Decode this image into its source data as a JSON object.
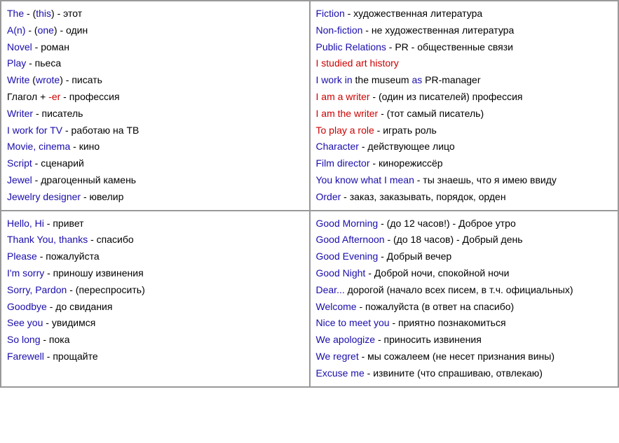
{
  "topLeft": {
    "lines": [
      {
        "parts": [
          {
            "text": "The",
            "color": "blue"
          },
          {
            "text": " - (",
            "color": "black"
          },
          {
            "text": "this",
            "color": "blue"
          },
          {
            "text": ") - этот",
            "color": "black"
          }
        ]
      },
      {
        "parts": [
          {
            "text": "A(n)",
            "color": "blue"
          },
          {
            "text": " - (",
            "color": "black"
          },
          {
            "text": "one",
            "color": "blue"
          },
          {
            "text": ") - один",
            "color": "black"
          }
        ]
      },
      {
        "parts": [
          {
            "text": "Novel",
            "color": "blue"
          },
          {
            "text": " - роман",
            "color": "black"
          }
        ]
      },
      {
        "parts": [
          {
            "text": "Play",
            "color": "blue"
          },
          {
            "text": " - пьеса",
            "color": "black"
          }
        ]
      },
      {
        "parts": [
          {
            "text": "Write",
            "color": "blue"
          },
          {
            "text": " (",
            "color": "black"
          },
          {
            "text": "wrote",
            "color": "blue"
          },
          {
            "text": ") - писать",
            "color": "black"
          }
        ]
      },
      {
        "parts": [
          {
            "text": "Глагол + ",
            "color": "black"
          },
          {
            "text": "-er",
            "color": "red"
          },
          {
            "text": " - профессия",
            "color": "black"
          }
        ]
      },
      {
        "parts": [
          {
            "text": "Writer",
            "color": "blue"
          },
          {
            "text": " - писатель",
            "color": "black"
          }
        ]
      },
      {
        "parts": [
          {
            "text": "I work for TV",
            "color": "blue"
          },
          {
            "text": " - работаю на ТВ",
            "color": "black"
          }
        ]
      },
      {
        "parts": [
          {
            "text": "Movie, cinema",
            "color": "blue"
          },
          {
            "text": " - кино",
            "color": "black"
          }
        ]
      },
      {
        "parts": [
          {
            "text": "Script",
            "color": "blue"
          },
          {
            "text": " - сценарий",
            "color": "black"
          }
        ]
      },
      {
        "parts": [
          {
            "text": "Jewel",
            "color": "blue"
          },
          {
            "text": " - драгоценный камень",
            "color": "black"
          }
        ]
      },
      {
        "parts": [
          {
            "text": "Jewelry designer",
            "color": "blue"
          },
          {
            "text": " - ювелир",
            "color": "black"
          }
        ]
      }
    ]
  },
  "topRight": {
    "lines": [
      {
        "parts": [
          {
            "text": "Fiction",
            "color": "blue"
          },
          {
            "text": " - художественная литература",
            "color": "black"
          }
        ]
      },
      {
        "parts": [
          {
            "text": "Non-fiction",
            "color": "blue"
          },
          {
            "text": " - не художественная литература",
            "color": "black"
          }
        ]
      },
      {
        "parts": [
          {
            "text": "Public Relations",
            "color": "blue"
          },
          {
            "text": " - PR - общественные связи",
            "color": "black"
          }
        ]
      },
      {
        "parts": [
          {
            "text": "I studied art history",
            "color": "red"
          }
        ]
      },
      {
        "parts": [
          {
            "text": "I work in",
            "color": "blue"
          },
          {
            "text": " the museum ",
            "color": "black"
          },
          {
            "text": "as",
            "color": "blue"
          },
          {
            "text": " PR-manager",
            "color": "black"
          }
        ]
      },
      {
        "parts": [
          {
            "text": "I am a writer",
            "color": "red"
          },
          {
            "text": " - (один из писателей) профессия",
            "color": "black"
          }
        ]
      },
      {
        "parts": [
          {
            "text": "I am the writer",
            "color": "red"
          },
          {
            "text": " - (тот самый писатель)",
            "color": "black"
          }
        ]
      },
      {
        "parts": [
          {
            "text": "To play a role",
            "color": "red"
          },
          {
            "text": " - играть роль",
            "color": "black"
          }
        ]
      },
      {
        "parts": [
          {
            "text": "Character",
            "color": "blue"
          },
          {
            "text": " - действующее лицо",
            "color": "black"
          }
        ]
      },
      {
        "parts": [
          {
            "text": "Film director",
            "color": "blue"
          },
          {
            "text": " - кинорежиссёр",
            "color": "black"
          }
        ]
      },
      {
        "parts": [
          {
            "text": "You know what I mean",
            "color": "blue"
          },
          {
            "text": " - ты знаешь, что я имею ввиду",
            "color": "black"
          }
        ]
      },
      {
        "parts": [
          {
            "text": "Order",
            "color": "blue"
          },
          {
            "text": " - заказ, заказывать, порядок, орден",
            "color": "black"
          }
        ]
      }
    ]
  },
  "bottomLeft": {
    "lines": [
      {
        "parts": [
          {
            "text": "Hello, Hi",
            "color": "blue"
          },
          {
            "text": " - привет",
            "color": "black"
          }
        ]
      },
      {
        "parts": [
          {
            "text": "Thank You, thanks",
            "color": "blue"
          },
          {
            "text": " - спасибо",
            "color": "black"
          }
        ]
      },
      {
        "parts": [
          {
            "text": "Please",
            "color": "blue"
          },
          {
            "text": " - пожалуйста",
            "color": "black"
          }
        ]
      },
      {
        "parts": [
          {
            "text": "I'm sorry",
            "color": "blue"
          },
          {
            "text": " - приношу извинения",
            "color": "black"
          }
        ]
      },
      {
        "parts": [
          {
            "text": "Sorry, Pardon",
            "color": "blue"
          },
          {
            "text": " - (переспросить)",
            "color": "black"
          }
        ]
      },
      {
        "parts": [
          {
            "text": "Goodbye",
            "color": "blue"
          },
          {
            "text": " - до свидания",
            "color": "black"
          }
        ]
      },
      {
        "parts": [
          {
            "text": "See you",
            "color": "blue"
          },
          {
            "text": " - увидимся",
            "color": "black"
          }
        ]
      },
      {
        "parts": [
          {
            "text": "So long",
            "color": "blue"
          },
          {
            "text": " - пока",
            "color": "black"
          }
        ]
      },
      {
        "parts": [
          {
            "text": "Farewell",
            "color": "blue"
          },
          {
            "text": " - прощайте",
            "color": "black"
          }
        ]
      }
    ]
  },
  "bottomRight": {
    "lines": [
      {
        "parts": [
          {
            "text": "Good Morning",
            "color": "blue"
          },
          {
            "text": " - (до 12 часов!) - Доброе утро",
            "color": "black"
          }
        ]
      },
      {
        "parts": [
          {
            "text": "Good Afternoon",
            "color": "blue"
          },
          {
            "text": " - (до 18 часов) - Добрый день",
            "color": "black"
          }
        ]
      },
      {
        "parts": [
          {
            "text": "Good Evening",
            "color": "blue"
          },
          {
            "text": " - Добрый вечер",
            "color": "black"
          }
        ]
      },
      {
        "parts": [
          {
            "text": "Good Night",
            "color": "blue"
          },
          {
            "text": " - Доброй ночи, спокойной ночи",
            "color": "black"
          }
        ]
      },
      {
        "parts": [
          {
            "text": "Dear...",
            "color": "blue"
          },
          {
            "text": " дорогой (начало всех писем, в т.ч. официальных)",
            "color": "black"
          }
        ]
      },
      {
        "parts": [
          {
            "text": "Welcome",
            "color": "blue"
          },
          {
            "text": " - пожалуйста (в ответ на спасибо)",
            "color": "black"
          }
        ]
      },
      {
        "parts": [
          {
            "text": "Nice to meet you",
            "color": "blue"
          },
          {
            "text": " - приятно познакомиться",
            "color": "black"
          }
        ]
      },
      {
        "parts": [
          {
            "text": "We apologize",
            "color": "blue"
          },
          {
            "text": " - приносить извинения",
            "color": "black"
          }
        ]
      },
      {
        "parts": [
          {
            "text": "We regret",
            "color": "blue"
          },
          {
            "text": " - мы сожалеем (не несет признания вины)",
            "color": "black"
          }
        ]
      },
      {
        "parts": [
          {
            "text": "Excuse me",
            "color": "blue"
          },
          {
            "text": " - извините (что спрашиваю, отвлекаю)",
            "color": "black"
          }
        ]
      }
    ]
  }
}
